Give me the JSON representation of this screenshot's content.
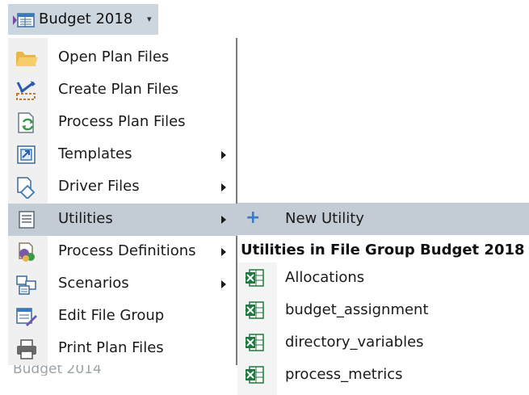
{
  "button": {
    "label": "Budget 2018",
    "caret": "▾"
  },
  "background_text": "Budget 2014",
  "menu": {
    "items": [
      {
        "label": "Open Plan Files",
        "icon": "folder-icon",
        "submenu": false
      },
      {
        "label": "Create Plan Files",
        "icon": "create-plan-icon",
        "submenu": false
      },
      {
        "label": "Process Plan Files",
        "icon": "process-plan-icon",
        "submenu": false
      },
      {
        "label": "Templates",
        "icon": "templates-icon",
        "submenu": true
      },
      {
        "label": "Driver Files",
        "icon": "driver-files-icon",
        "submenu": true
      },
      {
        "label": "Utilities",
        "icon": "utilities-icon",
        "submenu": true,
        "highlighted": true
      },
      {
        "label": "Process Definitions",
        "icon": "process-definitions-icon",
        "submenu": true
      },
      {
        "label": "Scenarios",
        "icon": "scenarios-icon",
        "submenu": true
      },
      {
        "label": "Edit File Group",
        "icon": "edit-file-group-icon",
        "submenu": false
      },
      {
        "label": "Print Plan Files",
        "icon": "printer-icon",
        "submenu": false
      }
    ]
  },
  "submenu": {
    "new_label": "New Utility",
    "header": "Utilities in File Group Budget 2018",
    "items": [
      {
        "label": "Allocations",
        "icon": "excel-icon"
      },
      {
        "label": "budget_assignment",
        "icon": "excel-icon"
      },
      {
        "label": "directory_variables",
        "icon": "excel-icon"
      },
      {
        "label": "process_metrics",
        "icon": "excel-icon"
      }
    ]
  },
  "colors": {
    "highlight": "#c3ccd4",
    "button_bg": "#ccd6df",
    "accent": "#3b78c2",
    "excel_green": "#1e7a3c"
  }
}
